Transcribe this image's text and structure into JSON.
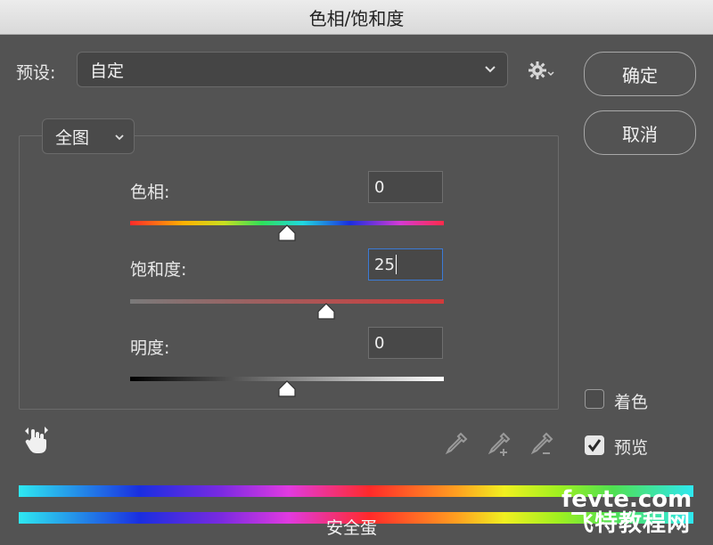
{
  "window": {
    "title": "色相/饱和度"
  },
  "preset": {
    "label": "预设:",
    "value": "自定"
  },
  "buttons": {
    "ok": "确定",
    "cancel": "取消"
  },
  "channel": {
    "value": "全图"
  },
  "adjustments": {
    "hue": {
      "label": "色相:",
      "value": "0",
      "slider_fraction": 0.5
    },
    "saturation": {
      "label": "饱和度:",
      "value": "25",
      "slider_fraction": 0.625
    },
    "lightness": {
      "label": "明度:",
      "value": "0",
      "slider_fraction": 0.5
    }
  },
  "options": {
    "colorize": {
      "label": "着色",
      "checked": false
    },
    "preview": {
      "label": "预览",
      "checked": true
    }
  },
  "icons": [
    "gear-icon",
    "chevron-down-icon",
    "targeted-adjustment-hand-icon",
    "eyedropper-icon",
    "eyedropper-add-icon",
    "eyedropper-subtract-icon",
    "checkmark-icon"
  ],
  "watermark": {
    "line1": "fevte.com",
    "line2": "飞特教程网"
  },
  "overlay_text": "安全蛋",
  "colors": {
    "background": "#535353",
    "focus": "#3b7bd6",
    "saturation_track": "#d23a3a"
  }
}
